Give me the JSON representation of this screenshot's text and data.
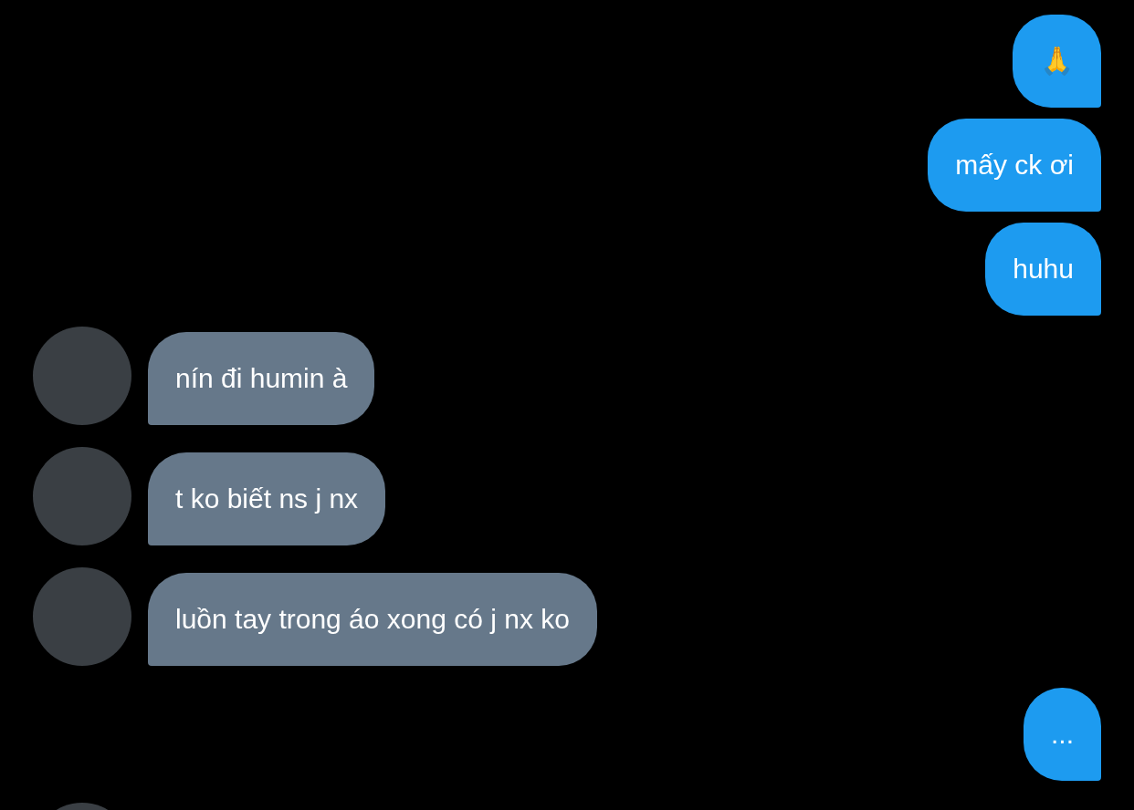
{
  "messages": [
    {
      "kind": "sent",
      "text": "🙏"
    },
    {
      "kind": "sent",
      "text": "mấy ck ơi"
    },
    {
      "kind": "sent",
      "text": "huhu"
    },
    {
      "kind": "received",
      "text": "nín đi humin à"
    },
    {
      "kind": "received",
      "text": "t ko biết ns j nx"
    },
    {
      "kind": "received",
      "text": "luồn tay trong áo xong có j nx ko"
    },
    {
      "kind": "sent",
      "text": "..."
    }
  ],
  "partial_avatar": true
}
